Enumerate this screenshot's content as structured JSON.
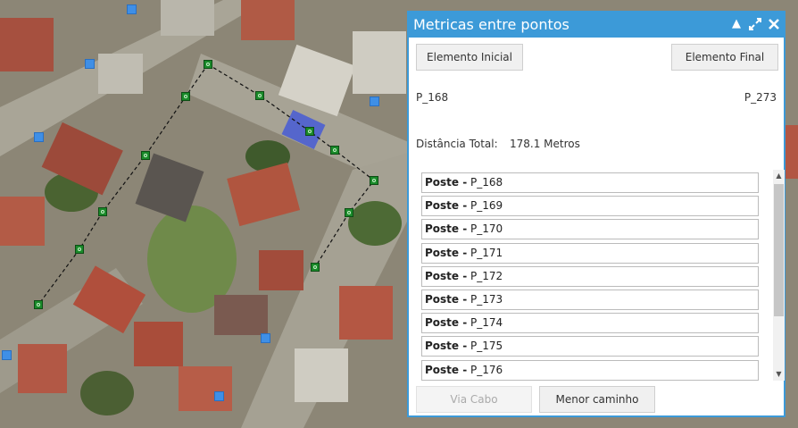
{
  "window": {
    "title": "Metricas entre pontos"
  },
  "buttons": {
    "start": "Elemento Inicial",
    "end": "Elemento Final",
    "via_cabo": "Via Cabo",
    "menor_caminho": "Menor caminho"
  },
  "selection": {
    "start_value": "P_168",
    "end_value": "P_273"
  },
  "distance": {
    "label": "Distância Total:",
    "value": "178.1 Metros"
  },
  "path_list": [
    {
      "type": "Poste -",
      "id": "P_168"
    },
    {
      "type": "Poste -",
      "id": "P_169"
    },
    {
      "type": "Poste -",
      "id": "P_170"
    },
    {
      "type": "Poste -",
      "id": "P_171"
    },
    {
      "type": "Poste -",
      "id": "P_172"
    },
    {
      "type": "Poste -",
      "id": "P_173"
    },
    {
      "type": "Poste -",
      "id": "P_174"
    },
    {
      "type": "Poste -",
      "id": "P_175"
    },
    {
      "type": "Poste -",
      "id": "P_176"
    }
  ],
  "colors": {
    "titlebar": "#3c9ad8",
    "node": "#1a8a2a",
    "marker": "#3f8fe6"
  },
  "icons": {
    "minimize": "caret-up-icon",
    "maximize": "expand-icon",
    "close": "close-icon"
  }
}
